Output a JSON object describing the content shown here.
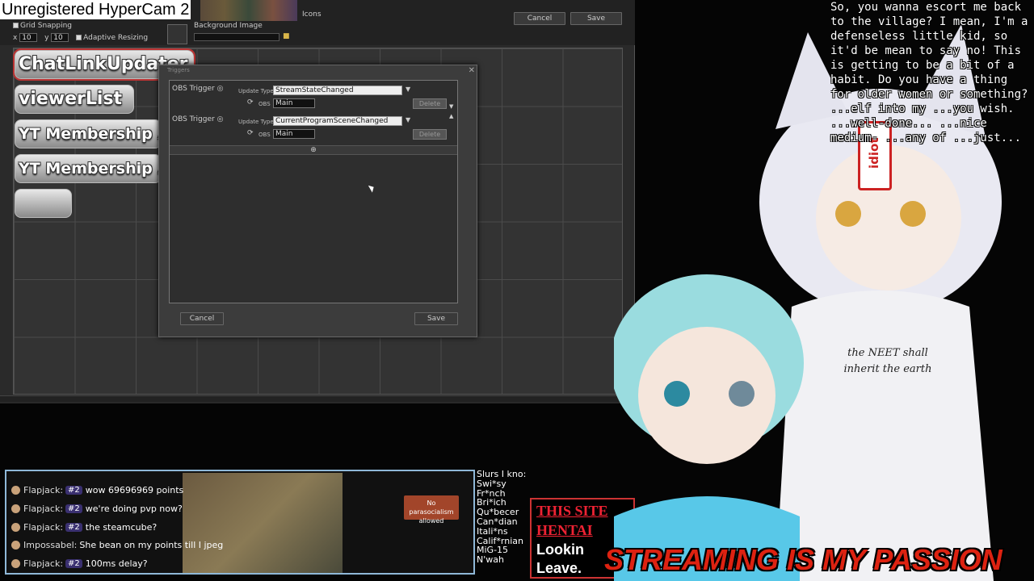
{
  "watermark": "Unregistered HyperCam 2",
  "editor": {
    "grid_snapping_label": "Grid Snapping",
    "x_label": "x",
    "x_value": "10",
    "y_label": "y",
    "y_value": "10",
    "adaptive_resizing_label": "Adaptive Resizing",
    "background_image_label": "Background Image",
    "icons_label": "Icons",
    "cancel_label": "Cancel",
    "save_label": "Save",
    "buttons": [
      "ChatLinkUpdater",
      "viewerList",
      "YT Membership A",
      "YT Membership A",
      ""
    ]
  },
  "triggers": {
    "title": "Triggers",
    "rows": [
      {
        "label": "OBS Trigger",
        "update_type_label": "Update Type",
        "update_type": "StreamStateChanged",
        "obs_label": "OBS",
        "obs": "Main",
        "delete_label": "Delete"
      },
      {
        "label": "OBS Trigger",
        "update_type_label": "Update Type",
        "update_type": "CurrentProgramSceneChanged",
        "obs_label": "OBS",
        "obs": "Main",
        "delete_label": "Delete"
      }
    ],
    "cancel_label": "Cancel",
    "save_label": "Save"
  },
  "chat": {
    "messages": [
      {
        "name": "Flapjack:",
        "badge": "#2",
        "text": "wow 69696969 points"
      },
      {
        "name": "Flapjack:",
        "badge": "#2",
        "text": "we're doing pvp now?"
      },
      {
        "name": "Flapjack:",
        "badge": "#2",
        "text": "the steamcube?"
      },
      {
        "name": "Impossabel:",
        "badge": "",
        "text": "She bean on my points till I jpeg"
      },
      {
        "name": "Flapjack:",
        "badge": "#2",
        "text": "100ms delay?"
      }
    ]
  },
  "sign": "No parasocialism allowed",
  "bg_list": [
    "Slurs I kno:",
    "Swi*sy",
    "Fr*nch",
    "Bri*ich",
    "Qu*becer",
    "Can*dian",
    "Itali*ns",
    "Calif*rnian",
    "MiG-15",
    "N'wah"
  ],
  "webpage": {
    "line1": "THIS SITE",
    "line2": "HENTAI",
    "line3": "Lookin",
    "line4": "Leave."
  },
  "quote": "So, you wanna escort me back to the village? I mean, I'm a defenseless little kid, so it'd be mean to say no! This is getting to be a bit of a habit. Do you have a thing for older women or something? ...elf into my ...you wish. ...well-done... ...nice medium- ...any of ...just...",
  "shirt_text": "the NEET shall inherit the earth",
  "hair_tag": "idiot",
  "banner": "STREAMING IS MY PASSION"
}
